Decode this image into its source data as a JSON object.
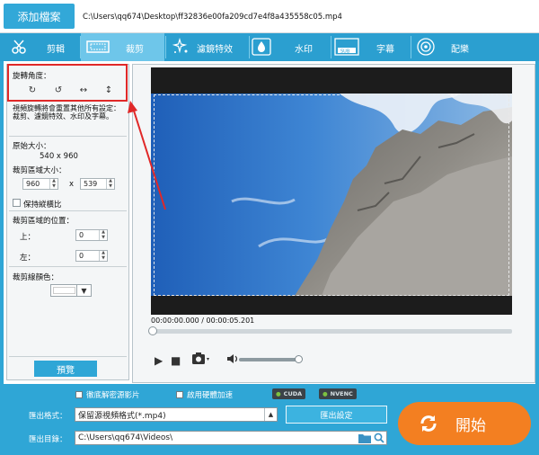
{
  "topbar": {
    "add_file_label": "添加檔案",
    "file_path": "C:\\Users\\qq674\\Desktop\\ff32836e00fa209cd7e4f8a435558c05.mp4"
  },
  "tabs": [
    {
      "label": "剪輯",
      "icon": "scissors-icon"
    },
    {
      "label": "裁剪",
      "icon": "crop-icon"
    },
    {
      "label": "濾鏡特效",
      "icon": "sparkle-icon"
    },
    {
      "label": "水印",
      "icon": "water-drop-icon"
    },
    {
      "label": "字幕",
      "icon": "subtitle-icon"
    },
    {
      "label": "配樂",
      "icon": "music-icon"
    }
  ],
  "left": {
    "rotation_title": "旋轉角度：",
    "description": "視頻旋轉將會重置其他所有設定：裁剪、濾鏡特效、水印及字幕。",
    "original_size_label": "原始大小：",
    "original_size_value": "540 x 960",
    "crop_size_label": "裁剪區域大小：",
    "crop_width": "960",
    "crop_x": "x",
    "crop_height": "539",
    "keep_ratio_label": "保持縱橫比",
    "crop_pos_label": "裁剪區域的位置：",
    "top_label": "上：",
    "top_value": "0",
    "left_label": "左：",
    "left_value": "0",
    "line_color_label": "裁剪線顏色：",
    "preview_label": "預覽"
  },
  "video": {
    "timecode": "00:00:00.000 / 00:00:05.201"
  },
  "bottom": {
    "hw_decode_label": "徹底解密源影片",
    "hw_accel_label": "啟用硬體加速",
    "cuda_label": "CUDA",
    "nvenc_label": "NVENC",
    "format_label": "匯出格式：",
    "format_value": "保留源視頻格式(*.mp4)",
    "export_settings_label": "匯出設定",
    "dir_label": "匯出目錄：",
    "dir_value": "C:\\Users\\qq674\\Videos\\",
    "start_label": "開始"
  },
  "colors": {
    "brand": "#2fa6d6",
    "active_tab": "#6ec6ea",
    "start": "#f37f21",
    "highlight": "#e02828"
  }
}
